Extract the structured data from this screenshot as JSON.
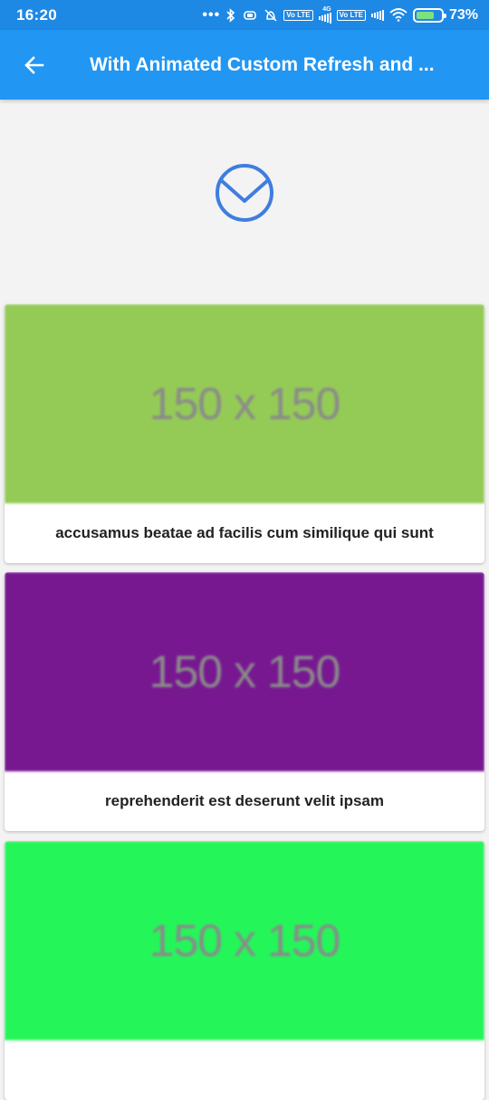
{
  "status_bar": {
    "time": "16:20",
    "battery_percent": "73%",
    "volte_label": "Vo LTE",
    "network_label": "4G"
  },
  "app_bar": {
    "title": "With Animated Custom Refresh and ...",
    "color": "#2196f3"
  },
  "refresh_indicator": {
    "icon": "mail-check-icon",
    "color": "#3f7de0"
  },
  "cards": [
    {
      "image_text": "150 x 150",
      "image_color": "#94cb56",
      "caption": "accusamus beatae ad facilis cum similique qui sunt"
    },
    {
      "image_text": "150 x 150",
      "image_color": "#771891",
      "caption": "reprehenderit est deserunt velit ipsam"
    },
    {
      "image_text": "150 x 150",
      "image_color": "#24f65a",
      "caption": ""
    }
  ]
}
